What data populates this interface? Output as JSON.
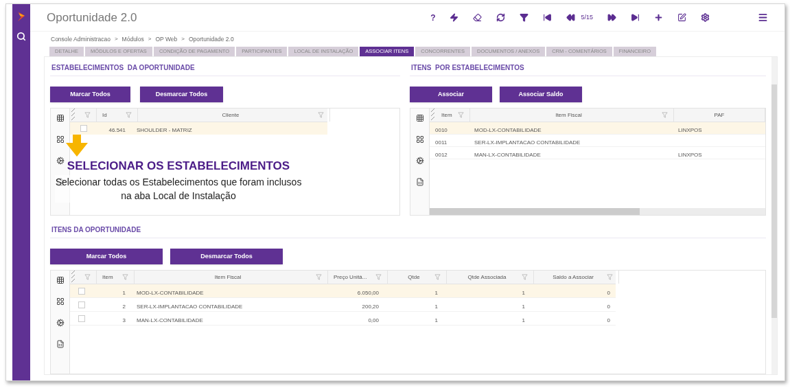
{
  "window": {
    "title": "Oportunidade 2.0"
  },
  "toolbar": {
    "help_glyph": "?",
    "page_counter": "5/15"
  },
  "breadcrumb": [
    "Console Administracao",
    "Módulos",
    "OP Web",
    "Oportunidade 2.0"
  ],
  "breadcrumb_separator": ">",
  "tabs": [
    {
      "label": "DETALHE",
      "selected": false
    },
    {
      "label": "MÓDULOS E OFERTAS",
      "selected": false
    },
    {
      "label": "CONDIÇÃO DE PAGAMENTO",
      "selected": false
    },
    {
      "label": "PARTICIPANTES",
      "selected": false
    },
    {
      "label": "LOCAL DE INSTALAÇÃO",
      "selected": false
    },
    {
      "label": "ASSOCIAR ITENS",
      "selected": true
    },
    {
      "label": "CONCORRENTES",
      "selected": false
    },
    {
      "label": "DOCUMENTOS / ANEXOS",
      "selected": false
    },
    {
      "label": "CRM - COMENTÁRIOS",
      "selected": false
    },
    {
      "label": "FINANCEIRO",
      "selected": false
    }
  ],
  "establishments": {
    "title": "ESTABELECIMENTOS  DA OPORTUNIDADE",
    "buttons": [
      "Marcar Todos",
      "Desmarcar Todos"
    ],
    "columns": [
      "Id",
      "Cliente"
    ],
    "rows": [
      {
        "id": "46.541",
        "cliente": "SHOULDER - MATRIZ",
        "checked": false,
        "selected": true
      }
    ]
  },
  "items_by_establishment": {
    "title": "ITENS  POR ESTABELECIMENTOS",
    "buttons": [
      "Associar",
      "Associar Saldo"
    ],
    "columns": [
      "Item",
      "Item Fiscal",
      "PAF"
    ],
    "rows": [
      {
        "item": "0010",
        "item_fiscal": "MOD-LX-CONTABILIDADE",
        "paf": "LINXPOS",
        "selected": true
      },
      {
        "item": "0011",
        "item_fiscal": "SER-LX-IMPLANTACAO CONTABILIDADE",
        "paf": "",
        "selected": false
      },
      {
        "item": "0012",
        "item_fiscal": "MAN-LX-CONTABILIDADE",
        "paf": "LINXPOS",
        "selected": false
      }
    ]
  },
  "opportunity_items": {
    "title": "ITENS DA OPORTUNIDADE",
    "buttons": [
      "Marcar Todos",
      "Desmarcar Todos"
    ],
    "columns": [
      "Item",
      "Item Fiscal",
      "Preço Unitá...",
      "Qtde",
      "Qtde Associada",
      "Saldo a Associar"
    ],
    "rows": [
      {
        "item": "1",
        "item_fiscal": "MOD-LX-CONTABILIDADE",
        "preco": "6.050,00",
        "qtde": "1",
        "qtde_associada": "1",
        "saldo": "0",
        "checked": false,
        "selected": true
      },
      {
        "item": "2",
        "item_fiscal": "SER-LX-IMPLANTACAO CONTABILIDADE",
        "preco": "200,20",
        "qtde": "1",
        "qtde_associada": "1",
        "saldo": "0",
        "checked": false,
        "selected": false
      },
      {
        "item": "3",
        "item_fiscal": "MAN-LX-CONTABILIDADE",
        "preco": "0,00",
        "qtde": "1",
        "qtde_associada": "1",
        "saldo": "0",
        "checked": false,
        "selected": false
      }
    ]
  },
  "callout": {
    "title": "SELECIONAR OS ESTABELECIMENTOS",
    "text": "Selecionar todas os Estabelecimentos que foram inclusos na aba Local de Instalação"
  }
}
